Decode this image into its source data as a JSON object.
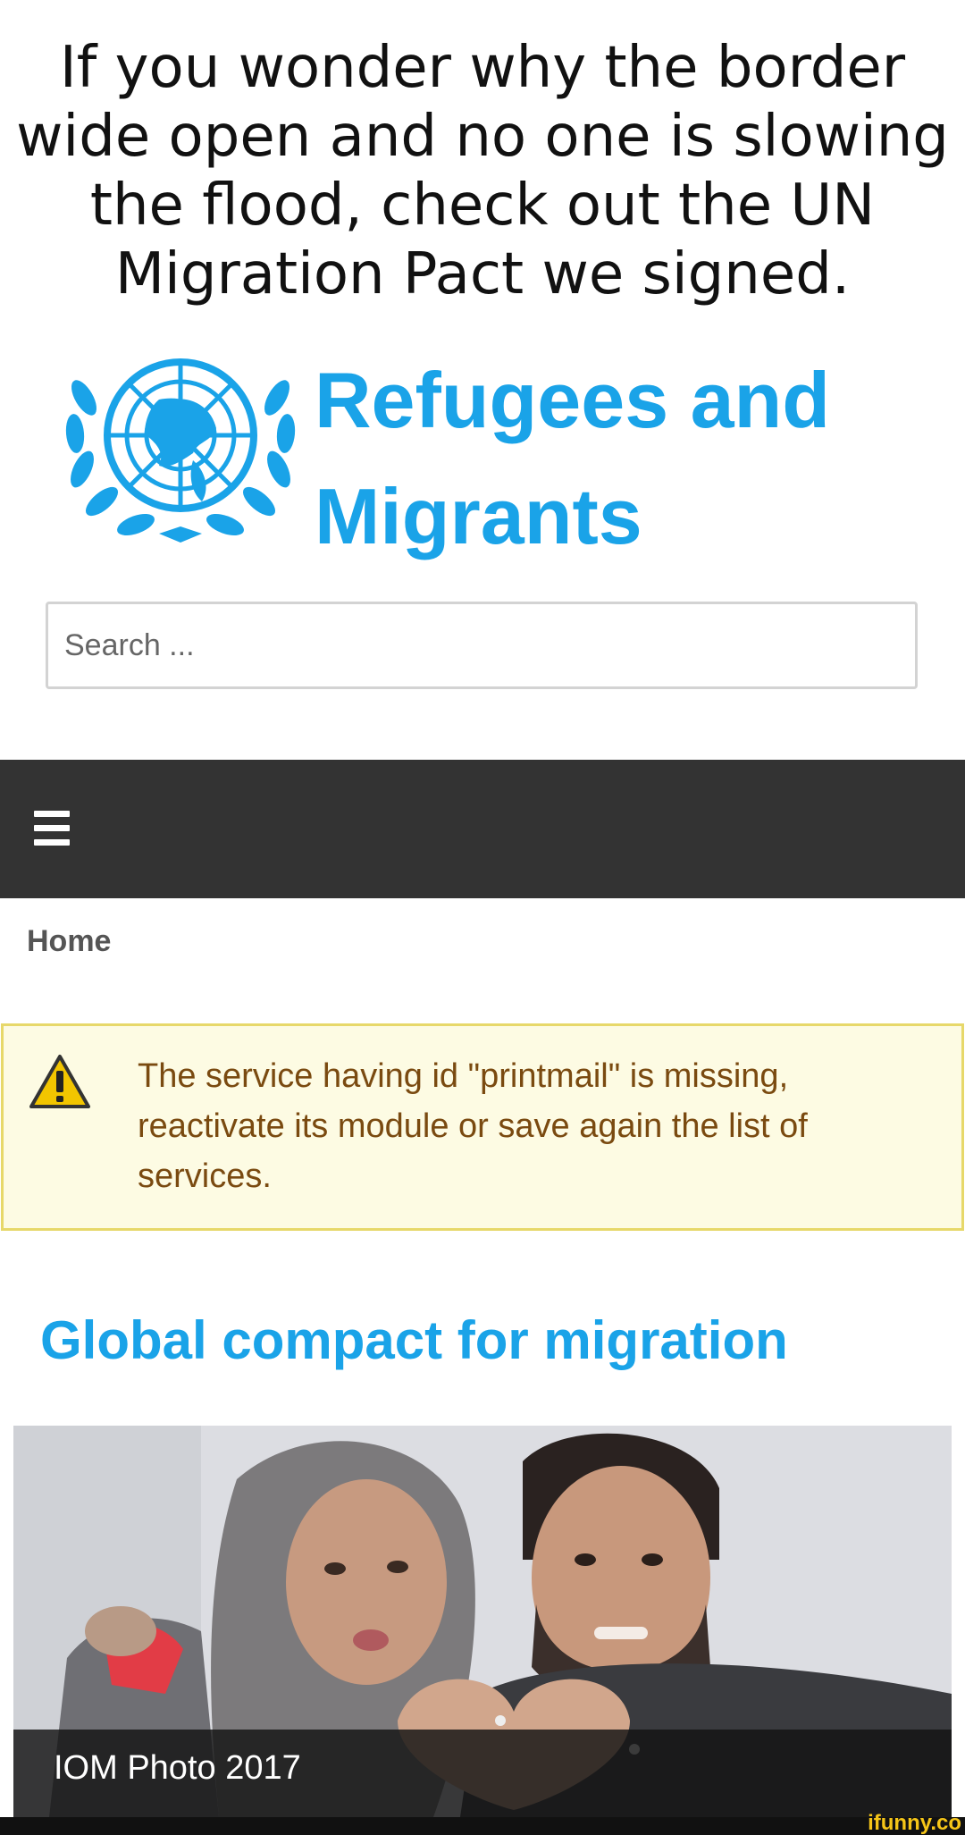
{
  "meme": {
    "caption_lines": [
      "If you wonder why the border",
      "wide open and no one is slowing",
      "the flood, check out the UN",
      "Migration Pact we signed."
    ]
  },
  "header": {
    "title_line1": "Refugees and",
    "title_line2": "Migrants",
    "emblem_icon": "un-emblem-icon",
    "brand_color": "#1aa3e8"
  },
  "search": {
    "placeholder": "Search ..."
  },
  "nav": {
    "menu_icon": "hamburger-icon",
    "background": "#333333"
  },
  "breadcrumb": {
    "home": "Home"
  },
  "alert": {
    "icon": "warning-icon",
    "message": "The service having id \"printmail\" is missing, reactivate its module or save again the list of services."
  },
  "article": {
    "title": "Global compact for migration",
    "photo_caption": "IOM Photo 2017"
  },
  "watermark": {
    "text": "ifunny.co"
  }
}
